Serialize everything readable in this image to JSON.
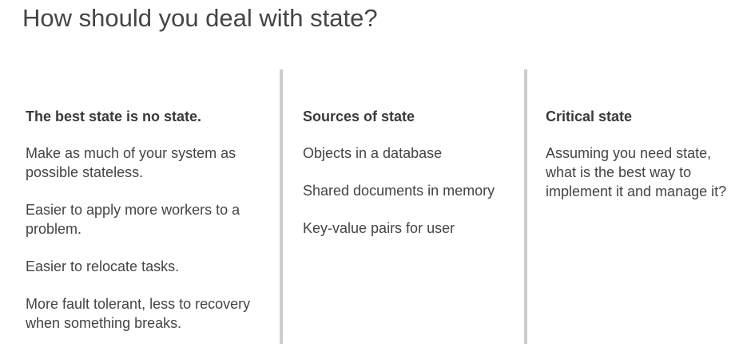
{
  "title": "How should you deal with state?",
  "columns": [
    {
      "heading": "The best state is no state.",
      "items": [
        "Make as much of your system as possible stateless.",
        "Easier to apply more workers to a problem.",
        "Easier to relocate tasks.",
        "More fault tolerant, less to recovery when something breaks."
      ]
    },
    {
      "heading": "Sources of state",
      "items": [
        "Objects in a database",
        "Shared documents in memory",
        "Key-value pairs for user"
      ]
    },
    {
      "heading": "Critical state",
      "items": [
        "Assuming you need state, what is the best way to implement it and manage it?"
      ]
    }
  ]
}
